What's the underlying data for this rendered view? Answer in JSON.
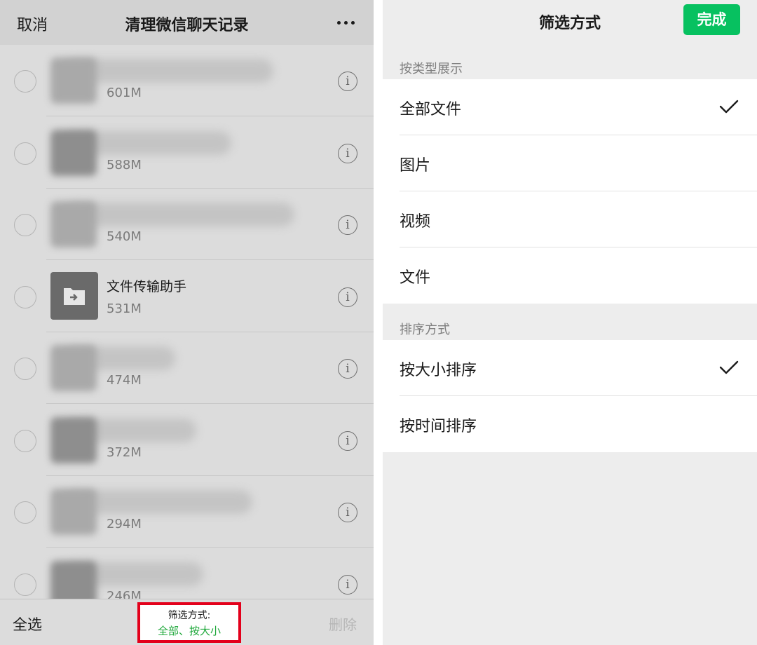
{
  "left": {
    "nav": {
      "cancel": "取消",
      "title": "清理微信聊天记录"
    },
    "rows": [
      {
        "size": "601M",
        "name": "",
        "type": "blurred",
        "bar": 300,
        "dark": false
      },
      {
        "size": "588M",
        "name": "",
        "type": "blurred",
        "bar": 240,
        "dark": true
      },
      {
        "size": "540M",
        "name": "",
        "type": "blurred",
        "bar": 330,
        "dark": false
      },
      {
        "size": "531M",
        "name": "文件传输助手",
        "type": "folder",
        "bar": 0,
        "dark": false
      },
      {
        "size": "474M",
        "name": "",
        "type": "blurred",
        "bar": 160,
        "dark": false
      },
      {
        "size": "372M",
        "name": "",
        "type": "blurred",
        "bar": 190,
        "dark": true
      },
      {
        "size": "294M",
        "name": "",
        "type": "blurred",
        "bar": 270,
        "dark": false
      },
      {
        "size": "246M",
        "name": "",
        "type": "blurred",
        "bar": 200,
        "dark": true
      }
    ],
    "bottom": {
      "select_all": "全选",
      "filter_label": "筛选方式:",
      "filter_value": "全部、按大小",
      "delete": "删除"
    }
  },
  "right": {
    "title": "筛选方式",
    "done": "完成",
    "type_section": {
      "label": "按类型展示",
      "options": [
        {
          "label": "全部文件",
          "checked": true
        },
        {
          "label": "图片",
          "checked": false
        },
        {
          "label": "视频",
          "checked": false
        },
        {
          "label": "文件",
          "checked": false
        }
      ]
    },
    "sort_section": {
      "label": "排序方式",
      "options": [
        {
          "label": "按大小排序",
          "checked": true
        },
        {
          "label": "按时间排序",
          "checked": false
        }
      ]
    }
  },
  "colors": {
    "accent_green": "#07c160",
    "filter_value_green": "#1fa83b",
    "highlight_red": "#e3001b"
  }
}
